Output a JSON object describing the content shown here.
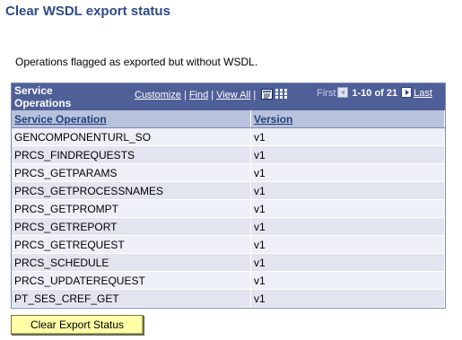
{
  "page": {
    "title": "Clear WSDL export status",
    "intro": "Operations flagged as exported but without WSDL."
  },
  "grid": {
    "caption": "Service Operations",
    "nav": {
      "customize": "Customize",
      "find": "Find",
      "view_all": "View All",
      "first": "First",
      "range": "1-10 of 21",
      "last": "Last"
    },
    "columns": [
      "Service Operation",
      "Version"
    ],
    "rows": [
      [
        "GENCOMPONENTURL_SO",
        "v1"
      ],
      [
        "PRCS_FINDREQUESTS",
        "v1"
      ],
      [
        "PRCS_GETPARAMS",
        "v1"
      ],
      [
        "PRCS_GETPROCESSNAMES",
        "v1"
      ],
      [
        "PRCS_GETPROMPT",
        "v1"
      ],
      [
        "PRCS_GETREPORT",
        "v1"
      ],
      [
        "PRCS_GETREQUEST",
        "v1"
      ],
      [
        "PRCS_SCHEDULE",
        "v1"
      ],
      [
        "PRCS_UPDATEREQUEST",
        "v1"
      ],
      [
        "PT_SES_CREF_GET",
        "v1"
      ]
    ]
  },
  "actions": {
    "clear_label": "Clear Export Status"
  },
  "icons": {
    "download": "download-to-excel-icon",
    "view_grid": "view-grid-icon",
    "prev": "previous-arrow-icon",
    "next": "next-arrow-icon"
  },
  "colors": {
    "title": "#2d4a8a",
    "grid_header": "#4f5f98",
    "column_header": "#b8c2dc",
    "button": "#ffffa8"
  }
}
